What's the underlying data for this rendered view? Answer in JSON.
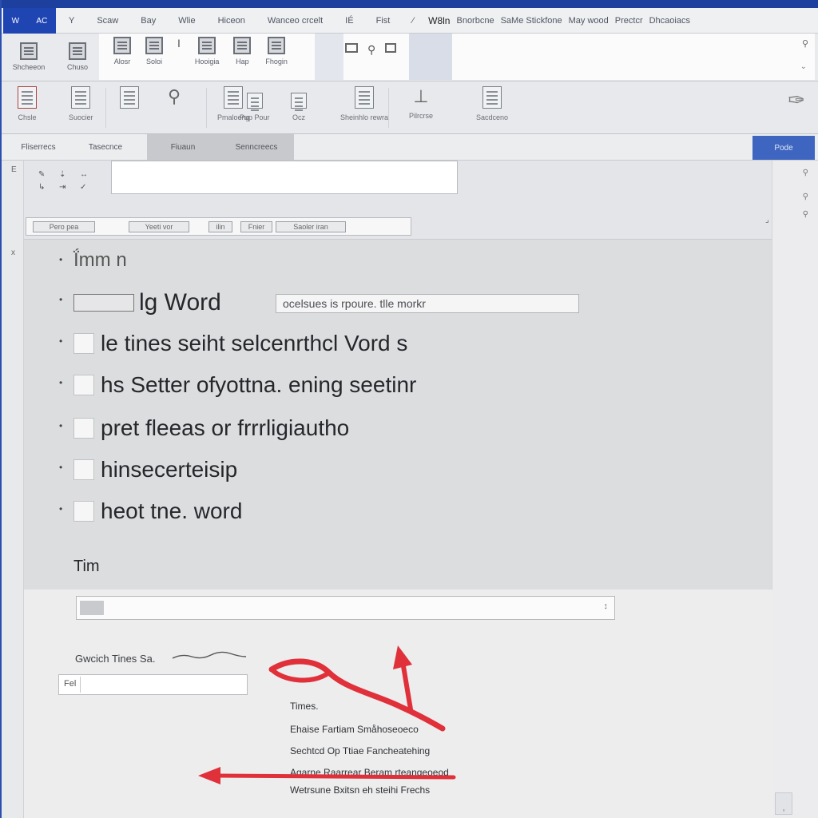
{
  "titlebar": {
    "badge_left": "W",
    "badge_right": "AC",
    "menu": [
      "Y",
      "Scaw",
      "Bay",
      "Wlie",
      "Hiceon",
      "Wanceo crcelt",
      "IÉ",
      "Fist",
      "⁄",
      "W8ln",
      "Bnorbcne",
      "SaMe Stickfone",
      "May wood",
      "Prectcr",
      "Dhcaoiacs"
    ]
  },
  "ribbon1": {
    "left_buttons": [
      "Shcheeon",
      "Chuso"
    ],
    "group_a": [
      "Alosr",
      "Soloi",
      "",
      "Hooigia",
      "Hap",
      "Fhogin"
    ],
    "group_b": [
      "",
      "",
      ""
    ]
  },
  "ribbon2": {
    "buttons": [
      "Chsle",
      "Suocier",
      "",
      "",
      "Pmaloeng",
      "Pup Pour",
      "Ocz",
      "Sheinhlo rewra",
      "Pilrcrse",
      "Sacdceno"
    ]
  },
  "tabs": {
    "items": [
      "Fliserrecs",
      "Tasecnce",
      "Fiuaun",
      "Senncreecs"
    ],
    "primary": "Pode"
  },
  "format_row": {
    "glyphs": [
      "✎",
      "⇣",
      "↔",
      "↳",
      "⇥",
      "✓"
    ]
  },
  "ruler": {
    "segments": [
      "Pero pea",
      "Yeeti vor",
      "ilin",
      "Fnier",
      "Saoler iran"
    ]
  },
  "document": {
    "line1": "Ḯmm n",
    "line2_suffix": "lg Word",
    "line2_field": "ocelsues is rpoure. tlle morkr",
    "line3": "le tines seiht selcenrthcl Vord s",
    "line4": "hs Setter ofyottna. ening seetinr",
    "line5": "pret fleeas or frrrligiautho",
    "line6": "hinsecerteisip",
    "line7": "heot tne. word",
    "subhead": "Tim"
  },
  "lower": {
    "search_end": "↕",
    "label": "Gwcich Tines Sa.",
    "small_input_label": "Fel",
    "list": [
      "Times.",
      "Ehaise Fartiam  Småhoseoeco",
      "Sechtcd Op Ttiae Fancheatehing",
      "Agarne Raarrear Beram rteangeoeod",
      "Wetrsune Bxitsn eh steihi Frechs"
    ]
  },
  "colors": {
    "accent": "#1d3f9e",
    "primary_button": "#3e66c0",
    "annotation_red": "#e0303a"
  },
  "icons": {
    "annotation": "red-arrow-icon",
    "scroll": "scroll-thumb-icon"
  }
}
